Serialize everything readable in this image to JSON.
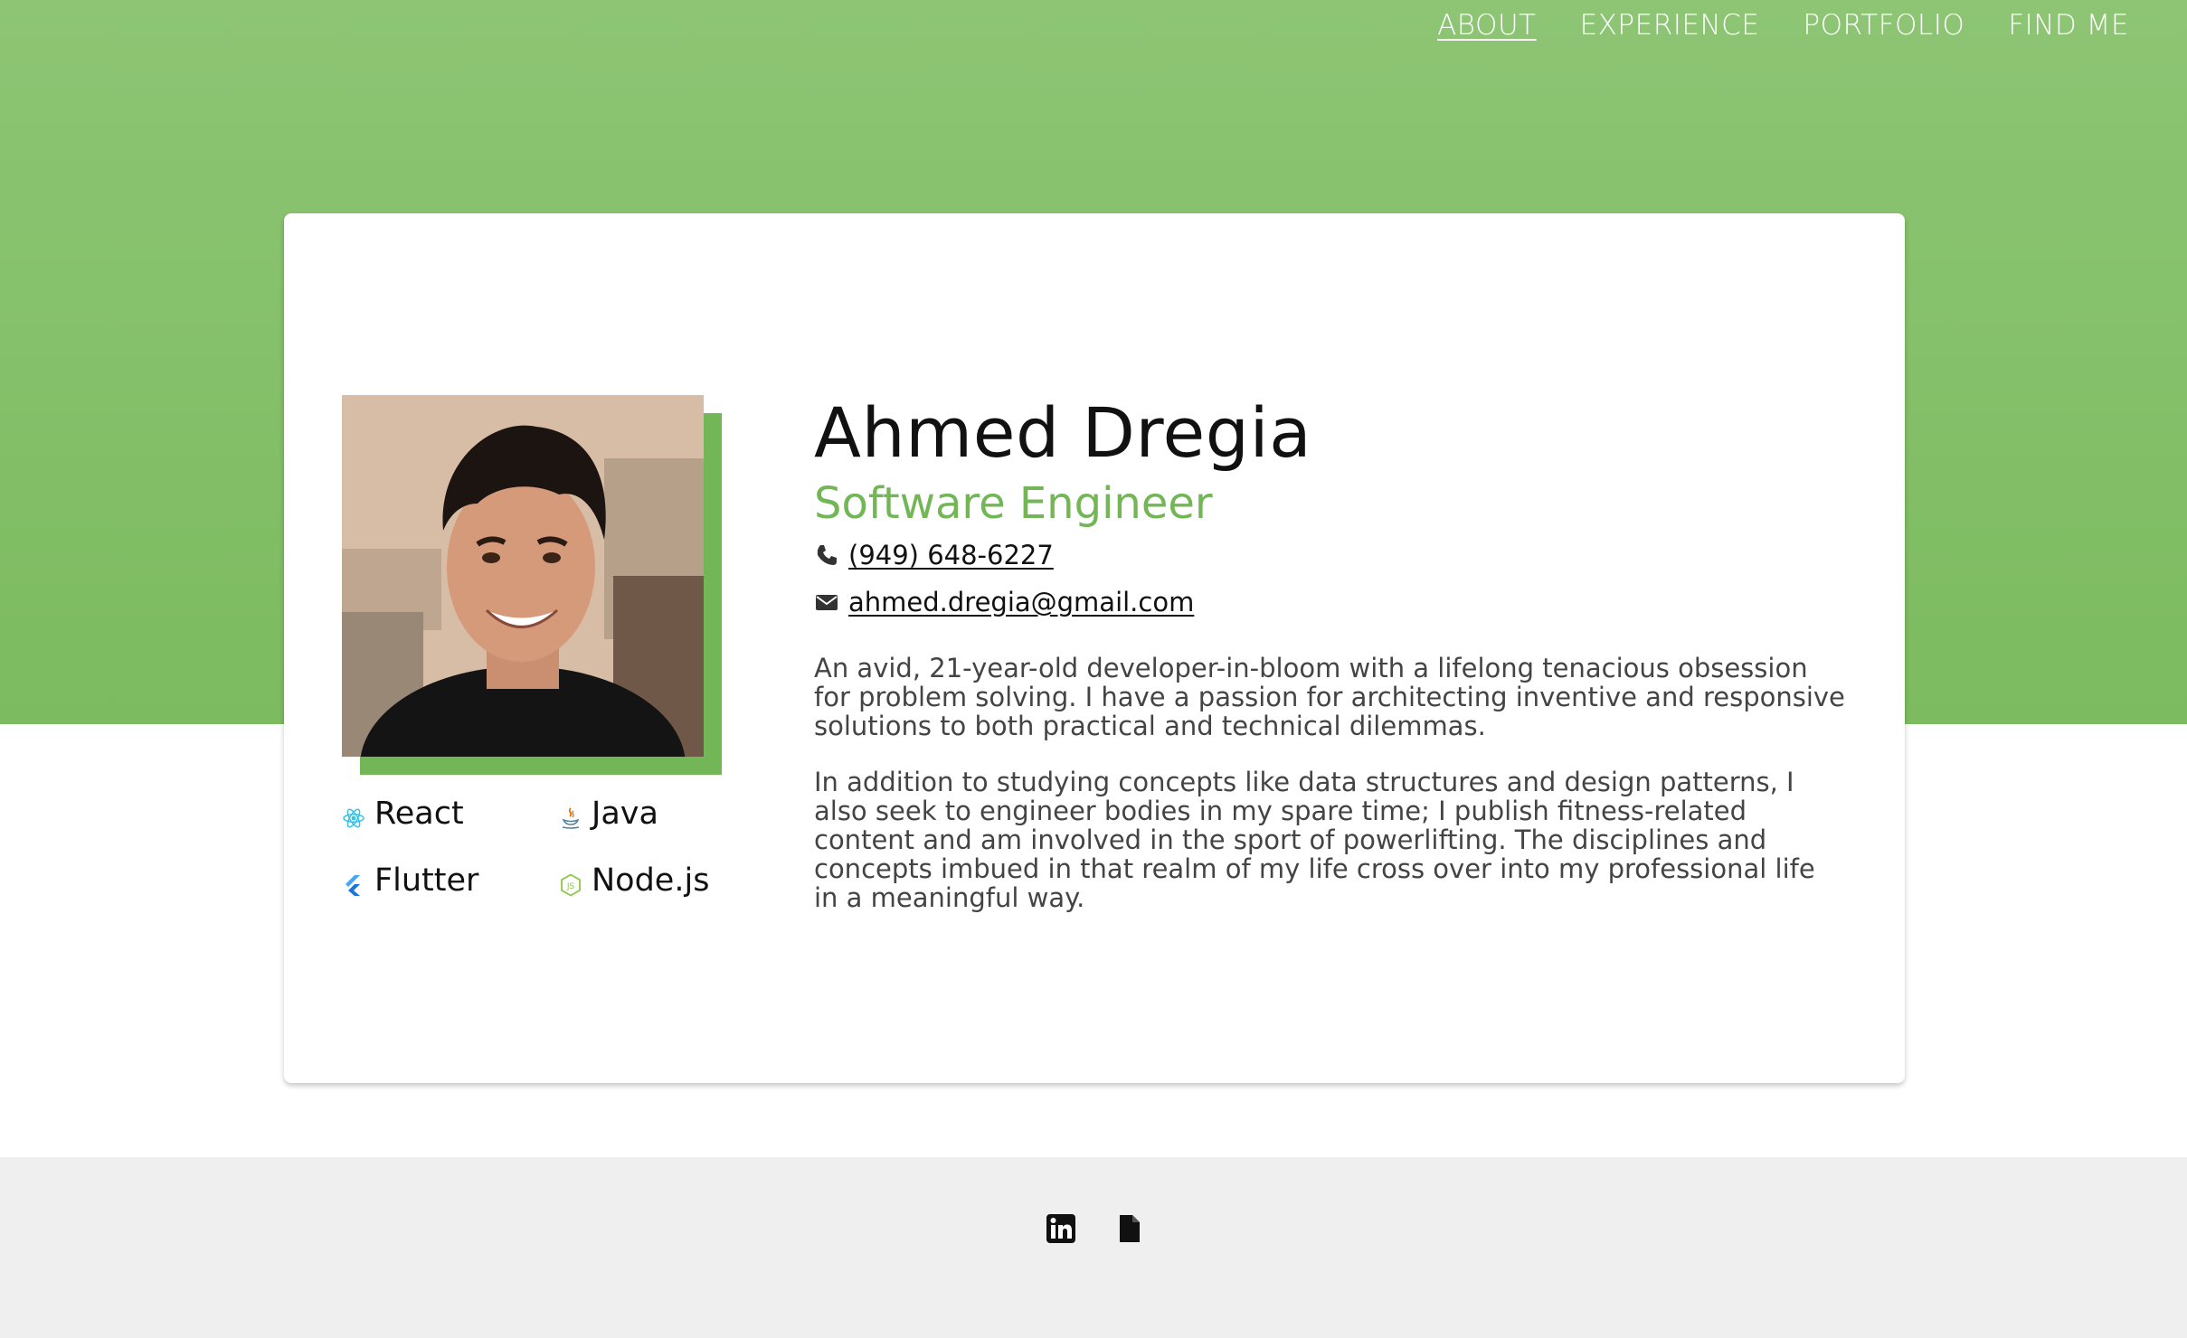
{
  "nav": {
    "items": [
      {
        "label": "ABOUT",
        "active": true
      },
      {
        "label": "EXPERIENCE",
        "active": false
      },
      {
        "label": "PORTFOLIO",
        "active": false
      },
      {
        "label": "FIND ME",
        "active": false
      }
    ]
  },
  "profile": {
    "name": "Ahmed Dregia",
    "role": "Software Engineer",
    "phone": "(949) 648-6227",
    "email": "ahmed.dregia@gmail.com",
    "bio": [
      "An avid, 21-year-old developer-in-bloom with a lifelong tenacious obsession for problem solving. I have a passion for architecting inventive and responsive solutions to both practical and technical dilemmas.",
      "In addition to studying concepts like data structures and design patterns, I also seek to engineer bodies in my spare time; I publish fitness-related content and am involved in the sport of powerlifting. The disciplines and concepts imbued in that realm of my life cross over into my professional life in a meaningful way."
    ]
  },
  "skills": [
    {
      "label": "React",
      "icon": "react-icon"
    },
    {
      "label": "Java",
      "icon": "java-icon"
    },
    {
      "label": "Flutter",
      "icon": "flutter-icon"
    },
    {
      "label": "Node.js",
      "icon": "nodejs-icon"
    }
  ],
  "footer": {
    "icons": [
      "linkedin-icon",
      "resume-file-icon"
    ]
  },
  "colors": {
    "accent": "#72b656",
    "hero_top": "#8dc574",
    "hero_bottom": "#7cbb5f",
    "footer_bg": "#efefef"
  }
}
